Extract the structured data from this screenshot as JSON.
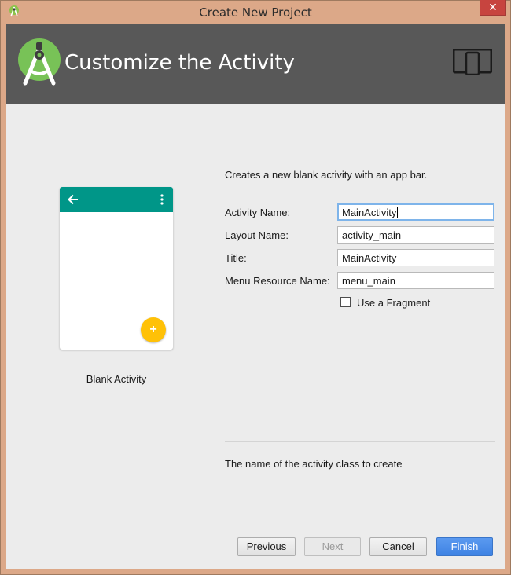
{
  "window": {
    "title": "Create New Project",
    "close_glyph": "✕"
  },
  "banner": {
    "title": "Customize the Activity"
  },
  "preview": {
    "template_name": "Blank Activity",
    "fab_glyph": "+"
  },
  "form": {
    "description": "Creates a new blank activity with an app bar.",
    "fields": [
      {
        "label": "Activity Name:",
        "value": "MainActivity"
      },
      {
        "label": "Layout Name:",
        "value": "activity_main"
      },
      {
        "label": "Title:",
        "value": "MainActivity"
      },
      {
        "label": "Menu Resource Name:",
        "value": "menu_main"
      }
    ],
    "use_fragment": {
      "label": "Use a Fragment",
      "checked": false
    },
    "hint": "The name of the activity class to create"
  },
  "buttons": {
    "previous": {
      "mnemonic": "P",
      "rest": "revious"
    },
    "next": "Next",
    "cancel": "Cancel",
    "finish": {
      "mnemonic": "F",
      "rest": "inish"
    }
  },
  "colors": {
    "accent": "#009688",
    "fab": "#ffc107",
    "banner": "#585858",
    "primary_button": "#4a8be8"
  },
  "icons": [
    "android-studio-icon",
    "android-studio-logo-icon",
    "device-form-factor-icon",
    "back-arrow-icon",
    "overflow-menu-icon"
  ]
}
